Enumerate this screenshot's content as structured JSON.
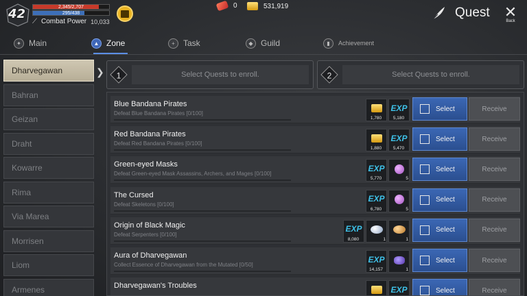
{
  "player": {
    "level": "42",
    "hp_text": "2,345/2,707",
    "hp_fraction": 0.866,
    "mp_text": "295/438",
    "mp_fraction": 0.674,
    "combat_power_label": "Combat Power",
    "combat_power_value": "10,033"
  },
  "currency": {
    "red_gem_count": "0",
    "gold_count": "531,919"
  },
  "header": {
    "title": "Quest",
    "back_label": "Back"
  },
  "tabs": [
    {
      "label": "Main",
      "icon": "compass-icon"
    },
    {
      "label": "Zone",
      "icon": "mountain-icon"
    },
    {
      "label": "Task",
      "icon": "plus-icon"
    },
    {
      "label": "Guild",
      "icon": "guild-icon"
    },
    {
      "label": "Achievement",
      "icon": "trophy-icon"
    }
  ],
  "zones": [
    "Dharvegawan",
    "Bahran",
    "Geizan",
    "Draht",
    "Kowarre",
    "Rima",
    "Via Marea",
    "Morrisen",
    "Liom",
    "Armenes"
  ],
  "slots": [
    {
      "number": "1",
      "text": "Select Quests to enroll."
    },
    {
      "number": "2",
      "text": "Select Quests to enroll."
    }
  ],
  "buttons": {
    "select": "Select",
    "receive": "Receive"
  },
  "quests": [
    {
      "title": "Blue Bandana Pirates",
      "desc": "Defeat Blue Bandana Pirates [0/100]",
      "rewards": [
        {
          "type": "gold",
          "qty": "1,780"
        },
        {
          "type": "exp",
          "glyph": "EXP",
          "qty": "5,180"
        }
      ]
    },
    {
      "title": "Red Bandana Pirates",
      "desc": "Defeat Red Bandana Pirates [0/100]",
      "rewards": [
        {
          "type": "gold",
          "qty": "1,880"
        },
        {
          "type": "exp",
          "glyph": "EXP",
          "qty": "5,470"
        }
      ]
    },
    {
      "title": "Green-eyed Masks",
      "desc": "Defeat Green-eyed Mask Assassins, Archers, and Mages [0/100]",
      "rewards": [
        {
          "type": "exp",
          "glyph": "EXP",
          "qty": "5,770"
        },
        {
          "type": "orb",
          "qty": "5"
        }
      ]
    },
    {
      "title": "The Cursed",
      "desc": "Defeat Skeletons [0/100]",
      "rewards": [
        {
          "type": "exp",
          "glyph": "EXP",
          "qty": "6,780"
        },
        {
          "type": "orb",
          "qty": "5"
        }
      ]
    },
    {
      "title": "Origin of Black Magic",
      "desc": "Defeat Serpenters [0/100]",
      "rewards": [
        {
          "type": "exp",
          "glyph": "EXP",
          "qty": "8,080"
        },
        {
          "type": "pearl",
          "qty": "1"
        },
        {
          "type": "shell",
          "qty": "1"
        }
      ]
    },
    {
      "title": "Aura of Dharvegawan",
      "desc": "Collect Essence of Dharvegawan from the Mutated [0/50]",
      "rewards": [
        {
          "type": "exp",
          "glyph": "EXP",
          "qty": "14,157"
        },
        {
          "type": "crystal",
          "qty": "1"
        }
      ]
    },
    {
      "title": "Dharvegawan's Troubles",
      "desc": "",
      "rewards": [
        {
          "type": "gold",
          "qty": ""
        },
        {
          "type": "exp",
          "glyph": "EXP",
          "qty": ""
        }
      ]
    }
  ],
  "colors": {
    "accent_blue": "#3b67b4",
    "hp_red": "#c73a2a",
    "mp_blue": "#3d6fb8",
    "exp_cyan": "#3ec1e8"
  }
}
